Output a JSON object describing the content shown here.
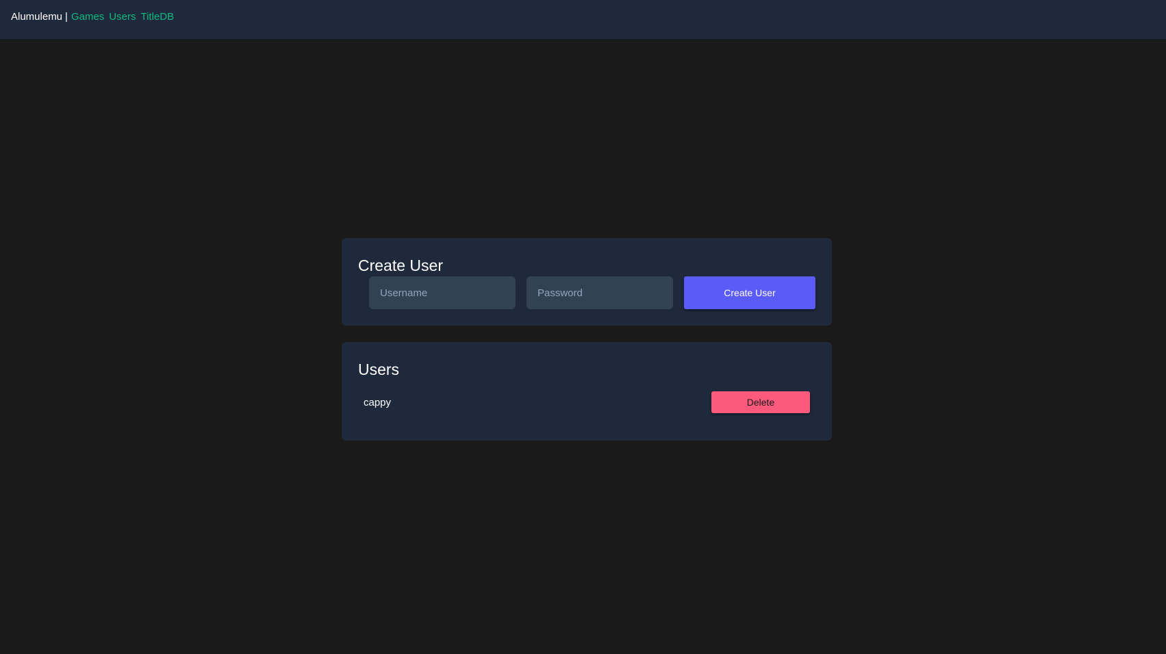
{
  "header": {
    "brand": "Alumulemu",
    "separator": "|",
    "nav": [
      {
        "label": "Games"
      },
      {
        "label": "Users"
      },
      {
        "label": "TitleDB"
      }
    ],
    "colors": {
      "background": "#1e293b",
      "link": "#10b981"
    }
  },
  "create_user": {
    "title": "Create User",
    "username_placeholder": "Username",
    "username_value": "",
    "password_placeholder": "Password",
    "password_value": "",
    "submit_label": "Create User",
    "submit_color": "#5b5bf7"
  },
  "users": {
    "title": "Users",
    "list": [
      {
        "name": "cappy",
        "delete_label": "Delete"
      }
    ],
    "delete_color": "#fb5a7c"
  }
}
